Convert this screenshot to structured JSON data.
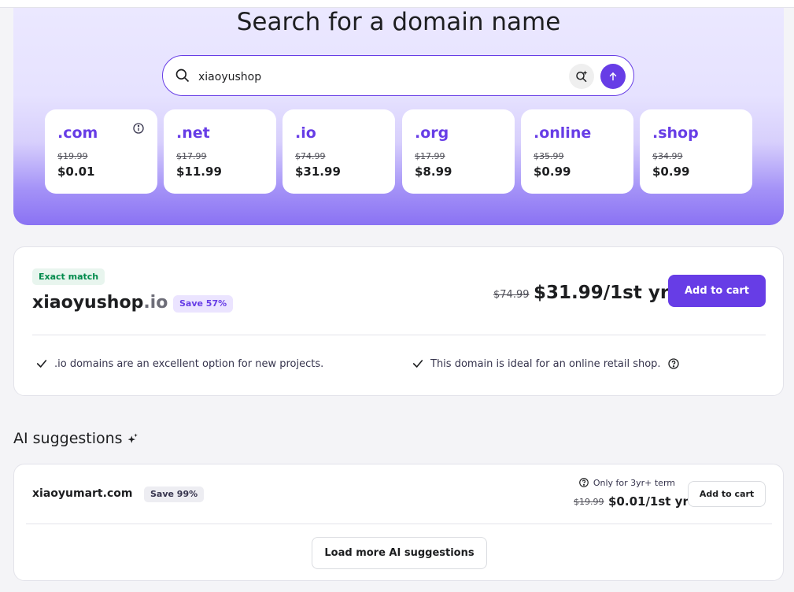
{
  "hero": {
    "title": "Search for a domain name",
    "search": {
      "value": "xiaoyushop"
    }
  },
  "tlds": [
    {
      "name": ".com",
      "old_price": "$19.99",
      "price": "$0.01",
      "has_info_icon": true
    },
    {
      "name": ".net",
      "old_price": "$17.99",
      "price": "$11.99"
    },
    {
      "name": ".io",
      "old_price": "$74.99",
      "price": "$31.99"
    },
    {
      "name": ".org",
      "old_price": "$17.99",
      "price": "$8.99"
    },
    {
      "name": ".online",
      "old_price": "$35.99",
      "price": "$0.99"
    },
    {
      "name": ".shop",
      "old_price": "$34.99",
      "price": "$0.99"
    }
  ],
  "exact_match": {
    "badge": "Exact match",
    "domain_name": "xiaoyushop",
    "domain_tld": ".io",
    "save_badge": "Save 57%",
    "old_price": "$74.99",
    "price": "$31.99/1st yr",
    "add_label": "Add to cart",
    "features": [
      ".io domains are an excellent option for new projects.",
      "This domain is ideal for an online retail shop."
    ]
  },
  "ai_suggestions": {
    "heading": "AI suggestions",
    "items": [
      {
        "domain": "xiaoyumart.com",
        "save_badge": "Save 99%",
        "term_note": "Only for 3yr+ term",
        "old_price": "$19.99",
        "price": "$0.01/1st yr",
        "add_label": "Add to cart"
      }
    ],
    "load_more_label": "Load more AI suggestions"
  },
  "colors": {
    "brand": "#673de6",
    "exact_badge_bg": "#e8f5ee",
    "exact_badge_text": "#008a4b"
  },
  "icons": [
    "search-icon",
    "ai-search-icon",
    "arrow-up-icon",
    "info-icon",
    "checkmark-icon",
    "help-icon",
    "sparkle-icon"
  ]
}
